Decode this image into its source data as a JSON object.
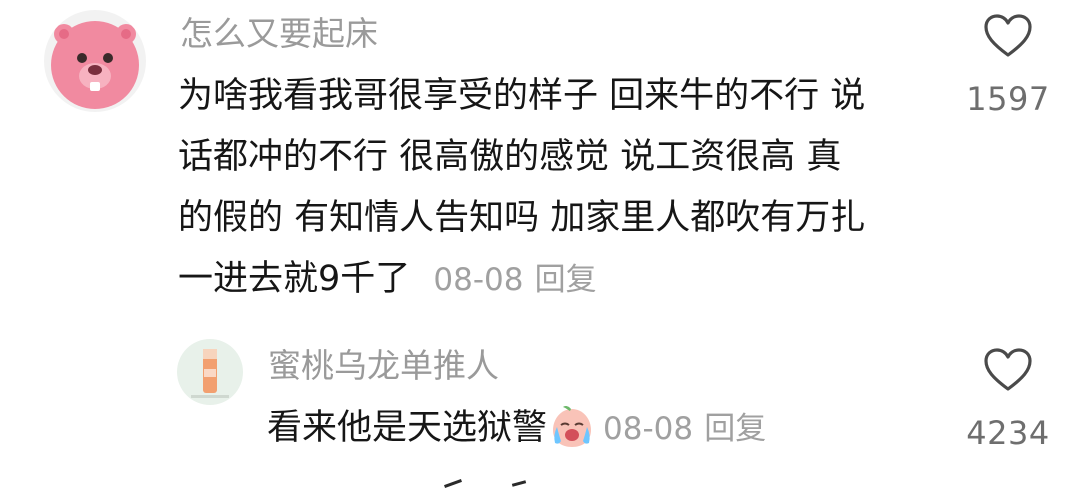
{
  "comments": [
    {
      "username": "怎么又要起床",
      "lines": [
        "为啥我看我哥很享受的样子 回来牛的不行 说",
        "话都冲的不行 很高傲的感觉 说工资很高 真",
        "的假的 有知情人告知吗 加家里人都吹有万扎"
      ],
      "last_line": "一进去就9千了",
      "date": "08-08",
      "reply_label": "回复",
      "likes": "1597",
      "avatar_icon": "pink-beaver-avatar-icon"
    },
    {
      "username": "蜜桃乌龙单推人",
      "text": "看来他是天选狱警",
      "emoji_icon": "crying-peach-emoji-icon",
      "date": "08-08",
      "reply_label": "回复",
      "likes": "4234",
      "avatar_icon": "peach-oolong-drink-avatar-icon"
    }
  ],
  "colors": {
    "username": "#9a9a9a",
    "text": "#161616",
    "meta": "#a0a0a0",
    "like_count": "#6e6e6e",
    "avatar_pink": "#f07f96"
  }
}
